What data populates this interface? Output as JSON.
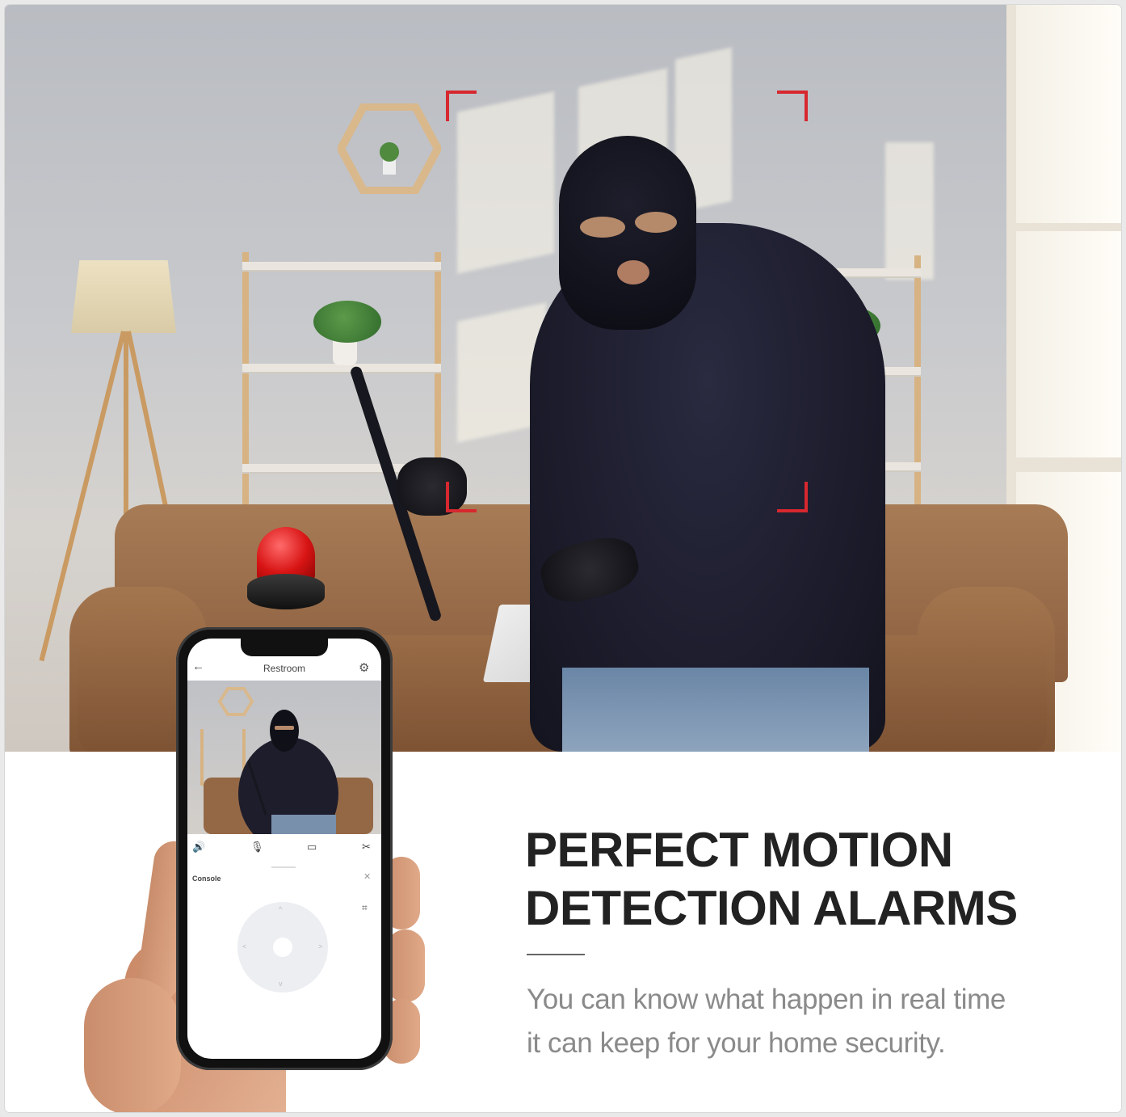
{
  "hero": {
    "headline_line1": "PERFECT MOTION",
    "headline_line2": "DETECTION ALARMS",
    "description_line1": "You can know what happen in real time",
    "description_line2": "it can keep for your home security."
  },
  "phone_app": {
    "camera_name": "Restroom",
    "console_label": "Console",
    "back_icon": "arrow-left-icon",
    "settings_icon": "gear-icon",
    "controls": [
      "speaker-icon",
      "microphone-icon",
      "record-icon",
      "scissors-icon"
    ],
    "close_icon": "close-icon",
    "screenshot_icon": "screenshot-icon"
  },
  "colors": {
    "bracket": "#d7282f",
    "headline": "#222222",
    "description": "#8a8a8a",
    "siren": "#d81414"
  }
}
